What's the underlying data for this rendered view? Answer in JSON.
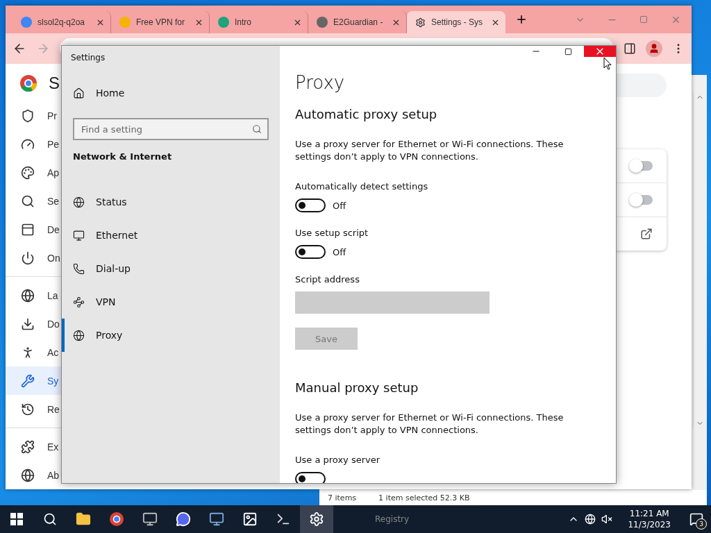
{
  "browser": {
    "tabs": [
      {
        "title": "slsol2q-q2oa",
        "selected": false
      },
      {
        "title": "Free VPN for",
        "selected": false
      },
      {
        "title": "Intro",
        "selected": false
      },
      {
        "title": "E2Guardian -",
        "selected": false
      },
      {
        "title": "Settings - Sys",
        "selected": true
      }
    ],
    "sidebar": {
      "title": "S",
      "items": [
        {
          "label": "Pr",
          "selected": false
        },
        {
          "label": "Pe",
          "selected": false
        },
        {
          "label": "Ap",
          "selected": false
        },
        {
          "label": "Se",
          "selected": false
        },
        {
          "label": "De",
          "selected": false
        },
        {
          "label": "On",
          "selected": false
        },
        {
          "label": "La",
          "selected": false
        },
        {
          "label": "Do",
          "selected": false
        },
        {
          "label": "Ac",
          "selected": false
        },
        {
          "label": "Sy",
          "selected": true
        },
        {
          "label": "Re",
          "selected": false
        },
        {
          "label": "Ex",
          "selected": false
        },
        {
          "label": "Ab",
          "selected": false
        }
      ]
    },
    "toggles": [
      {
        "on": false
      },
      {
        "on": false
      }
    ]
  },
  "explorer": {
    "status": [
      "7 items",
      "1 item selected  52.3 KB"
    ],
    "taskbar_label": "Registry"
  },
  "settings": {
    "title": "Settings",
    "home": "Home",
    "search": {
      "placeholder": "Find a setting"
    },
    "section": "Network & Internet",
    "nav": [
      {
        "label": "Status",
        "selected": false
      },
      {
        "label": "Ethernet",
        "selected": false
      },
      {
        "label": "Dial-up",
        "selected": false
      },
      {
        "label": "VPN",
        "selected": false
      },
      {
        "label": "Proxy",
        "selected": true
      }
    ],
    "page_title": "Proxy",
    "groups": [
      {
        "heading": "Automatic proxy setup",
        "description": "Use a proxy server for Ethernet or Wi-Fi connections. These settings don’t apply to VPN connections.",
        "controls": [
          {
            "kind": "toggle",
            "label": "Automatically detect settings",
            "on": false,
            "state_text": "Off"
          },
          {
            "kind": "toggle",
            "label": "Use setup script",
            "on": false,
            "state_text": "Off"
          },
          {
            "kind": "field",
            "label": "Script address",
            "disabled": true
          },
          {
            "kind": "button",
            "label": "Save",
            "disabled": true
          }
        ]
      },
      {
        "heading": "Manual proxy setup",
        "description": "Use a proxy server for Ethernet or Wi-Fi connections. These settings don’t apply to VPN connections.",
        "controls": [
          {
            "kind": "toggle",
            "label": "Use a proxy server",
            "on": false
          }
        ]
      }
    ]
  },
  "taskbar": {
    "apps": [
      {
        "selected": false
      },
      {
        "selected": false
      },
      {
        "selected": false
      },
      {
        "selected": false
      },
      {
        "selected": false
      },
      {
        "selected": false
      },
      {
        "selected": false
      },
      {
        "selected": true
      }
    ],
    "time": "11:21 AM",
    "date": "11/3/2023",
    "notifications": "3"
  }
}
